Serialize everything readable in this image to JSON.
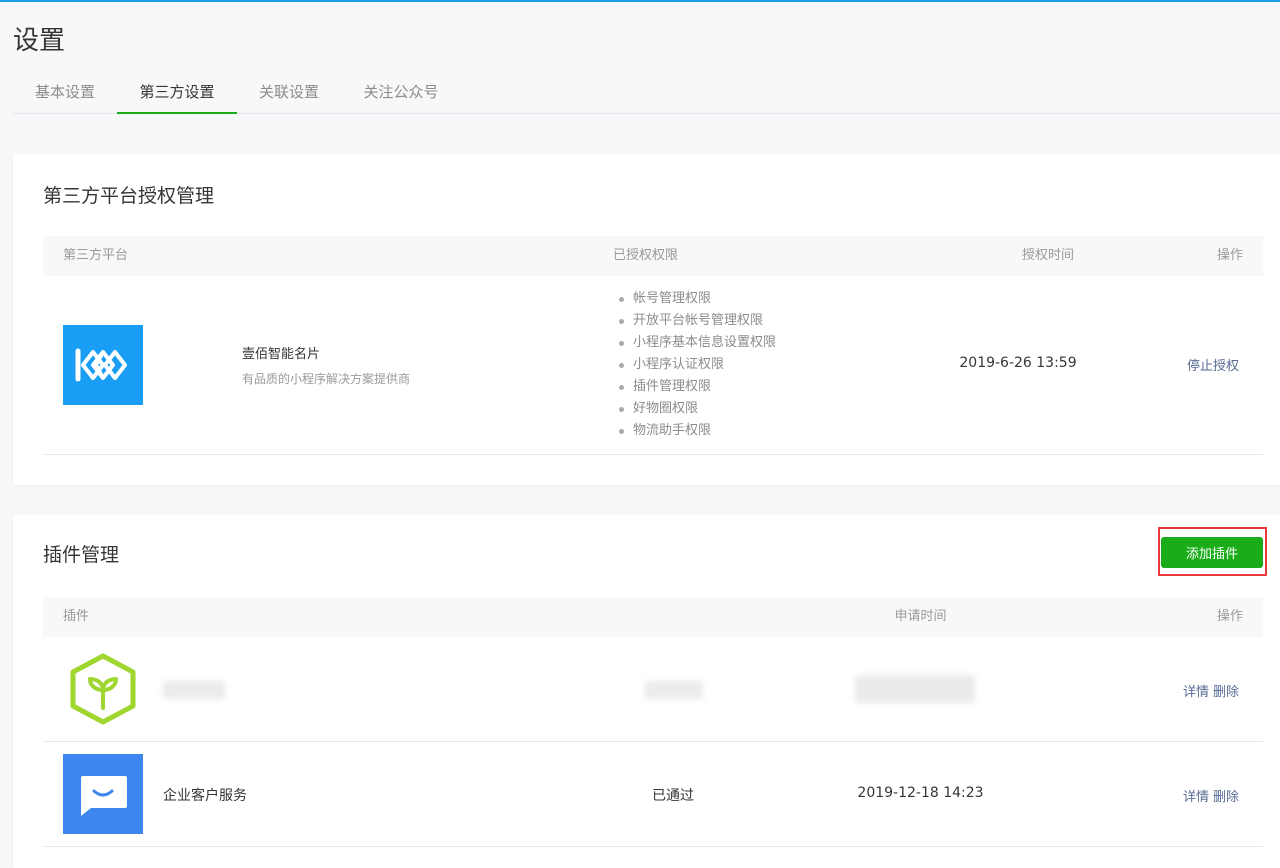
{
  "page": {
    "title": "设置"
  },
  "tabs": [
    {
      "label": "基本设置"
    },
    {
      "label": "第三方设置",
      "active": true
    },
    {
      "label": "关联设置"
    },
    {
      "label": "关注公众号"
    }
  ],
  "third_party": {
    "title": "第三方平台授权管理",
    "columns": {
      "platform": "第三方平台",
      "permissions": "已授权权限",
      "auth_time": "授权时间",
      "operation": "操作"
    },
    "rows": [
      {
        "logo": "koo-logo-icon",
        "name": "壹佰智能名片",
        "description": "有品质的小程序解决方案提供商",
        "permissions": [
          "帐号管理权限",
          "开放平台帐号管理权限",
          "小程序基本信息设置权限",
          "小程序认证权限",
          "插件管理权限",
          "好物圈权限",
          "物流助手权限"
        ],
        "auth_time": "2019-6-26 13:59",
        "action": "停止授权"
      }
    ]
  },
  "plugins": {
    "title": "插件管理",
    "add_button": "添加插件",
    "columns": {
      "plugin": "插件",
      "apply_time": "申请时间",
      "operation": "操作"
    },
    "rows": [
      {
        "logo": "sprout-hexagon-icon",
        "name": "",
        "status": "",
        "apply_time": "",
        "details": "详情",
        "delete": "删除"
      },
      {
        "logo": "chat-bubble-icon",
        "name": "企业客户服务",
        "status": "已通过",
        "apply_time": "2019-12-18 14:23",
        "details": "详情",
        "delete": "删除"
      }
    ]
  },
  "colors": {
    "accent_green": "#1aad19",
    "link_blue": "#576b95",
    "highlight_red": "#e8393c",
    "top_bar_blue": "#1aa0e6",
    "koo_logo_blue": "#1a9ef5",
    "chat_logo_blue": "#3d86ef",
    "sprout_green": "#9fd62f"
  }
}
